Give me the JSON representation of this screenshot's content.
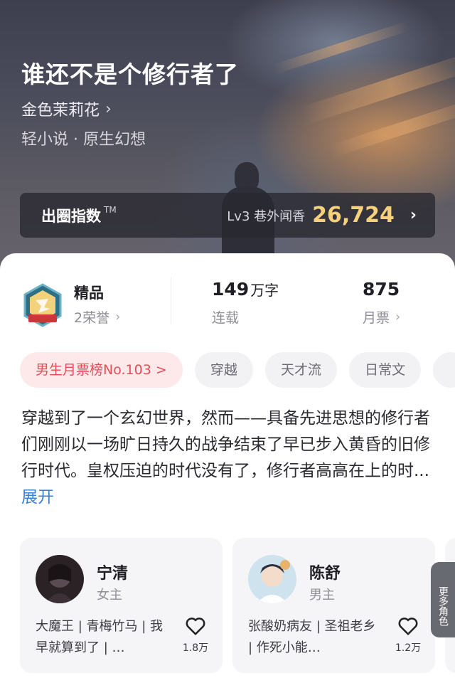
{
  "book": {
    "title": "谁还不是个修行者了",
    "author": "金色茉莉花",
    "genre": "轻小说 · 原生幻想"
  },
  "index_bar": {
    "label": "出圈指数",
    "tm": "TM",
    "level_text": "Lv3 巷外闻香",
    "score": "26,724"
  },
  "stats": {
    "quality": {
      "title": "精品",
      "honors": "2荣誉"
    },
    "words": {
      "value": "149",
      "unit": "万字",
      "status": "连载"
    },
    "tickets": {
      "value": "875",
      "label": "月票"
    }
  },
  "tags": [
    {
      "label": "男生月票榜No.103 >",
      "kind": "rank"
    },
    {
      "label": "穿越",
      "kind": "plain"
    },
    {
      "label": "天才流",
      "kind": "plain"
    },
    {
      "label": "日常文",
      "kind": "plain"
    }
  ],
  "synopsis": {
    "text": "穿越到了一个玄幻世界，然而——具备先进思想的修行者们刚刚以一场旷日持久的战争结束了早已步入黄昏的旧修行时代。皇权压迫的时代没有了，修行者高高在上的时...",
    "expand_label": "展开"
  },
  "roles": [
    {
      "name": "宁清",
      "type": "女主",
      "desc": "大魔王 | 青梅竹马 | 我早就算到了 | …",
      "likes": "1.8万"
    },
    {
      "name": "陈舒",
      "type": "男主",
      "desc": "张酸奶病友 | 圣祖老乡 | 作死小能…",
      "likes": "1.2万"
    }
  ],
  "more_roles_label": "更多角色",
  "colors": {
    "accent_gold": "#f6d07a",
    "rank_tag_text": "#e44c57",
    "rank_tag_bg": "#fde9ea",
    "link_blue": "#3b82d6"
  }
}
